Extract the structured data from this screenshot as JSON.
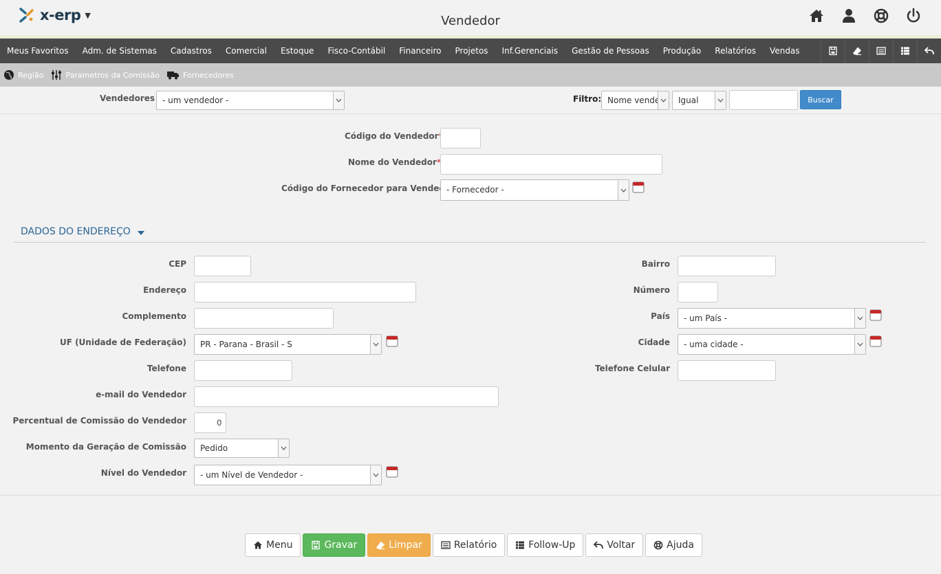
{
  "app": {
    "logo_text": "x-erp",
    "page_title": "Vendedor"
  },
  "header_icons": [
    "home-icon",
    "user-icon",
    "lifebuoy-icon",
    "power-icon"
  ],
  "menu": {
    "items": [
      "Meus Favoritos",
      "Adm. de Sistemas",
      "Cadastros",
      "Comercial",
      "Estoque",
      "Fisco-Contábil",
      "Financeiro",
      "Projetos",
      "Inf.Gerenciais",
      "Gestão de Pessoas",
      "Produção",
      "Relatórios",
      "Vendas"
    ],
    "tools": [
      "save-icon",
      "eraser-icon",
      "report-icon",
      "list-icon",
      "back-icon"
    ]
  },
  "subbar": {
    "items": [
      "Região",
      "Parametros da Comissão",
      "Fornecedores"
    ]
  },
  "search": {
    "vendedores_label": "Vendedores",
    "vendedores_value": "- um vendedor -",
    "filtro_label": "Filtro:",
    "filter_field": "Nome vende",
    "filter_op": "Igual",
    "filter_value": "",
    "buscar_label": "Buscar"
  },
  "form": {
    "codigo_label": "Código do Vendedor",
    "nome_label": "Nome do Vendedor",
    "required_mark": "*",
    "fornecedor_label": "Código do Fornecedor para Vendedor",
    "fornecedor_value": "- Fornecedor -"
  },
  "address": {
    "section_title": "DADOS DO ENDEREÇO",
    "cep_label": "CEP",
    "endereco_label": "Endereço",
    "complemento_label": "Complemento",
    "uf_label": "UF (Unidade de Federação)",
    "uf_value": "PR - Parana - Brasil - S",
    "telefone_label": "Telefone",
    "email_label": "e-mail do Vendedor",
    "comissao_label": "Percentual de Comissão do Vendedor",
    "comissao_value": "0",
    "momento_label": "Momento da Geração de Comissão",
    "momento_value": "Pedido",
    "nivel_label": "Nível do Vendedor",
    "nivel_value": "- um Nível de Vendedor -",
    "bairro_label": "Bairro",
    "numero_label": "Número",
    "pais_label": "País",
    "pais_value": "- um País -",
    "cidade_label": "Cidade",
    "cidade_value": "- uma cidade -",
    "celular_label": "Telefone Celular"
  },
  "footer": {
    "menu": "Menu",
    "gravar": "Gravar",
    "limpar": "Limpar",
    "relatorio": "Relatório",
    "followup": "Follow-Up",
    "voltar": "Voltar",
    "ajuda": "Ajuda"
  },
  "colors": {
    "primary": "#428bca",
    "success": "#5cb85c",
    "warning": "#f0ad4e",
    "menubar": "#4a4a4a",
    "section": "#2a6496"
  }
}
